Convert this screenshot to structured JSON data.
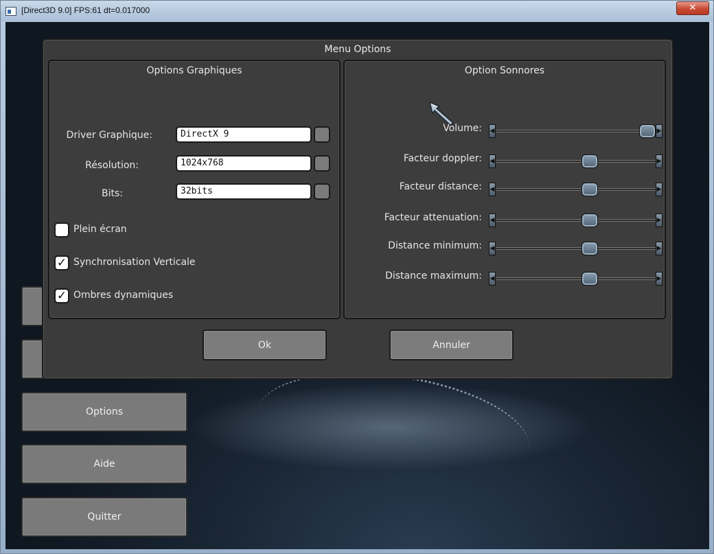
{
  "window": {
    "title": "[Direct3D 9.0] FPS:61 dt=0.017000",
    "close_glyph": "✕"
  },
  "background_menu": {
    "items": [
      {
        "label": ""
      },
      {
        "label": ""
      },
      {
        "label": "Options"
      },
      {
        "label": "Aide"
      },
      {
        "label": "Quitter"
      }
    ]
  },
  "dialog": {
    "title": "Menu Options",
    "graphics": {
      "title": "Options Graphiques",
      "fields": [
        {
          "label": "Driver Graphique:",
          "value": "DirectX 9"
        },
        {
          "label": "Résolution:",
          "value": "1024x768"
        },
        {
          "label": "Bits:",
          "value": "32bits"
        }
      ],
      "checkboxes": [
        {
          "label": "Plein écran",
          "checked": false,
          "mark": ""
        },
        {
          "label": "Synchronisation Verticale",
          "checked": true,
          "mark": "✓"
        },
        {
          "label": "Ombres dynamiques",
          "checked": true,
          "mark": "✓"
        }
      ]
    },
    "sound": {
      "title": "Option Sonnores",
      "sliders": [
        {
          "label": "Volume:",
          "value": 1.0
        },
        {
          "label": "Facteur doppler:",
          "value": 0.6
        },
        {
          "label": "Facteur distance:",
          "value": 0.6
        },
        {
          "label": "Facteur attenuation:",
          "value": 0.6
        },
        {
          "label": "Distance minimum:",
          "value": 0.6
        },
        {
          "label": "Distance maximum:",
          "value": 0.6
        }
      ]
    },
    "ok_label": "Ok",
    "cancel_label": "Annuler"
  },
  "icons": {
    "cursor": "arrow-cursor-icon",
    "window": "app-window-icon",
    "slider_left": "arrow-left-icon",
    "slider_right": "arrow-right-icon",
    "dropdown": "dropdown-button-icon"
  }
}
